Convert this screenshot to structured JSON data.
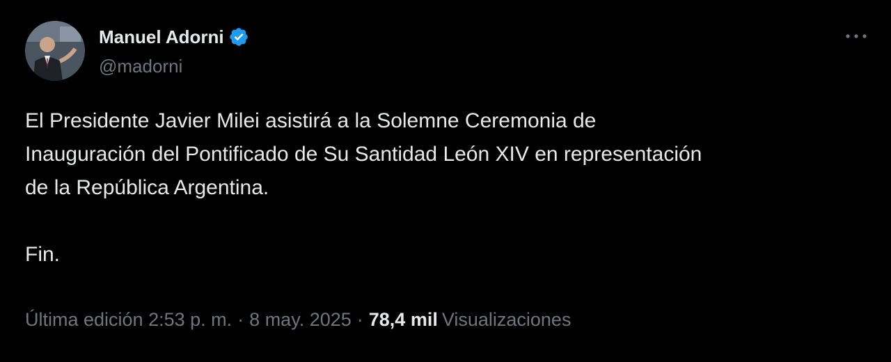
{
  "author": {
    "display_name": "Manuel Adorni",
    "handle": "@madorni",
    "verified_color": "#1d9bf0"
  },
  "tweet": {
    "paragraphs": [
      "El Presidente Javier Milei asistirá a la Solemne Ceremonia de\nInauguración del Pontificado de Su Santidad León XIV en representación\nde la República Argentina.",
      "Fin."
    ]
  },
  "meta": {
    "edited_label": "Última edición",
    "time": "2:53 p. m.",
    "date": "8 may. 2025",
    "separator": "·",
    "views_count": "78,4 mil",
    "views_label": "Visualizaciones"
  },
  "icons": {
    "verified": "verified-badge-icon",
    "more": "more-options-icon"
  },
  "colors": {
    "background": "#000000",
    "primary_text": "#e7e9ea",
    "secondary_text": "#71767b",
    "accent": "#1d9bf0"
  }
}
